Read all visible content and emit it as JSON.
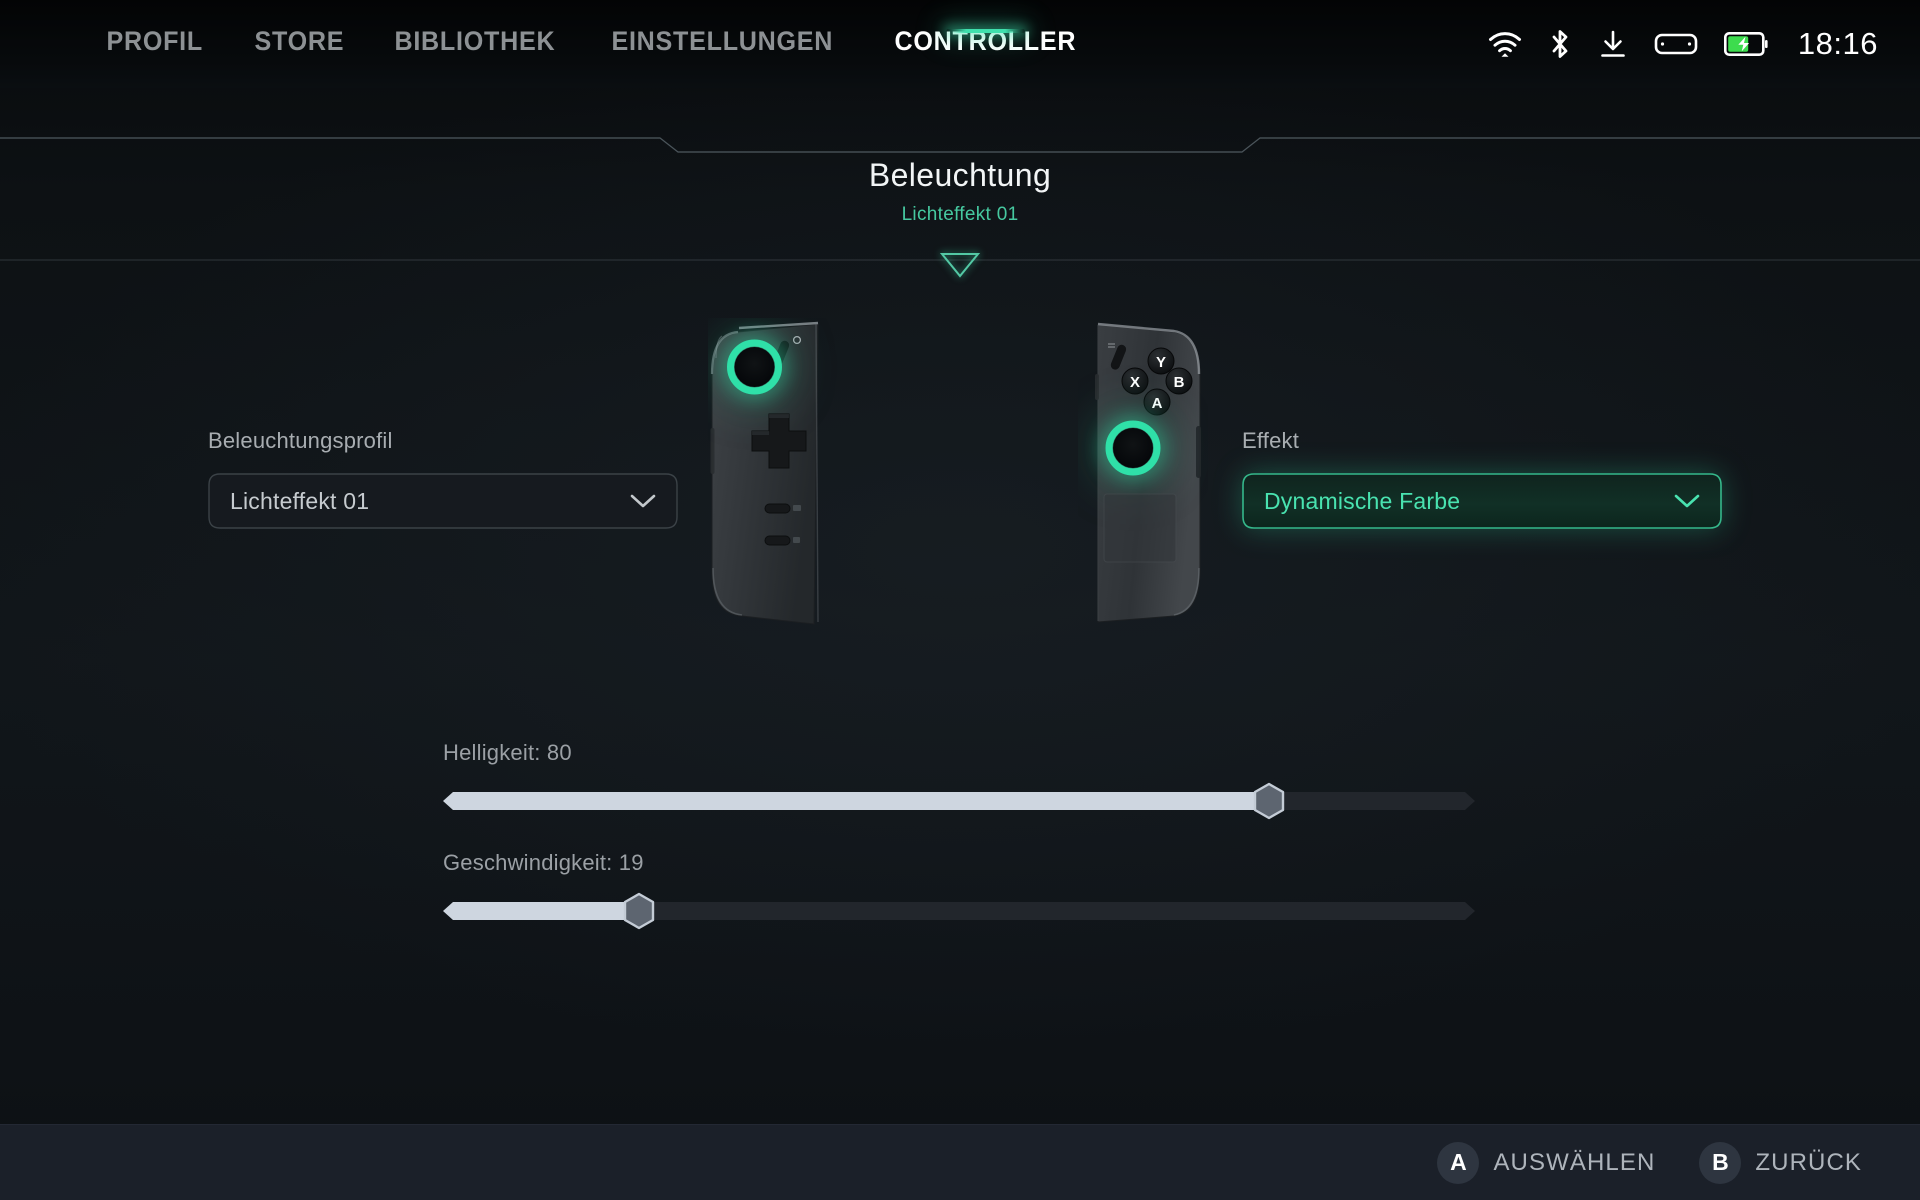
{
  "nav": {
    "items": [
      {
        "label": "PROFIL",
        "active": false
      },
      {
        "label": "STORE",
        "active": false
      },
      {
        "label": "BIBLIOTHEK",
        "active": false
      },
      {
        "label": "EINSTELLUNGEN",
        "active": false
      },
      {
        "label": "CONTROLLER",
        "active": true
      }
    ]
  },
  "status": {
    "icons": [
      "wifi-icon",
      "bluetooth-icon",
      "download-icon",
      "handheld-device-icon",
      "battery-charging-icon"
    ],
    "battery_charging": true,
    "clock": "18:16"
  },
  "section": {
    "title": "Beleuchtung",
    "subtitle": "Lichteffekt 01"
  },
  "options": {
    "profile": {
      "label": "Beleuchtungsprofil",
      "value": "Lichteffekt 01",
      "chevron": "chevron-down-icon",
      "selected": false
    },
    "effect": {
      "label": "Effekt",
      "value": "Dynamische Farbe",
      "chevron": "chevron-down-icon",
      "selected": true
    }
  },
  "sliders": [
    {
      "name": "brightness",
      "label": "Helligkeit: 80",
      "value": 80,
      "min": 0,
      "max": 100
    },
    {
      "name": "speed",
      "label": "Geschwindigkeit: 19",
      "value": 19,
      "min": 0,
      "max": 100
    }
  ],
  "controllers": {
    "left": {
      "name": "left-joycon",
      "stick_glow": "#2fe0a8",
      "dpad": "dpad-icon",
      "small_buttons": [
        "minus-button",
        "capture-button"
      ]
    },
    "right": {
      "name": "right-joycon",
      "stick_glow": "#2fe0a8",
      "face_buttons": [
        "Y",
        "X",
        "B",
        "A"
      ],
      "touchpad": "touchpad-area"
    }
  },
  "footer": {
    "hints": [
      {
        "button": "A",
        "label": "AUSWÄHLEN"
      },
      {
        "button": "B",
        "label": "ZURÜCK"
      }
    ]
  },
  "colors": {
    "accent": "#3fe0ad",
    "accent_dim": "#46c9a0",
    "background": "#0d1114",
    "topbar": "#070a0c",
    "footer": "#1b2029",
    "battery_green": "#3ddc4e",
    "slider_fill": "#ced6e0"
  }
}
